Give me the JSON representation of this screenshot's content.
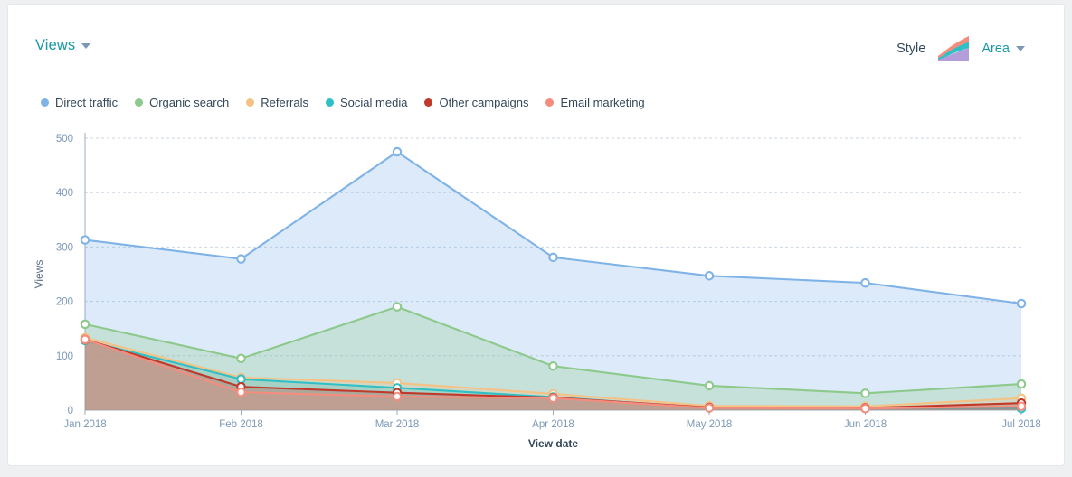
{
  "header": {
    "views_dropdown_label": "Views",
    "style_label": "Style",
    "style_dropdown_label": "Area",
    "caret_icon": "chevron-down-icon",
    "area_chart_icon": "area-chart-icon"
  },
  "colors": {
    "direct_traffic": "#7fb3e8",
    "organic_search": "#8cc98a",
    "referrals": "#f5c285",
    "social_media": "#2fc0c6",
    "other_campaigns": "#c0392b",
    "email_marketing": "#f58d7f",
    "accent_teal": "#1898a8",
    "text_dark": "#33475b",
    "tick_text": "#7c98b6",
    "grid": "#cbd6e2",
    "card_bg": "#ffffff",
    "page_bg": "#eef0f2"
  },
  "legend": [
    {
      "label": "Direct traffic",
      "color": "#7fb3e8"
    },
    {
      "label": "Organic search",
      "color": "#8cc98a"
    },
    {
      "label": "Referrals",
      "color": "#f5c285"
    },
    {
      "label": "Social media",
      "color": "#2fc0c6"
    },
    {
      "label": "Other campaigns",
      "color": "#c0392b"
    },
    {
      "label": "Email marketing",
      "color": "#f58d7f"
    }
  ],
  "chart_data": {
    "type": "area",
    "title": "",
    "xlabel": "View date",
    "ylabel": "Views",
    "categories": [
      "Jan 2018",
      "Feb 2018",
      "Mar 2018",
      "Apr 2018",
      "May 2018",
      "Jun 2018",
      "Jul 2018"
    ],
    "yticks": [
      0,
      100,
      200,
      300,
      400,
      500
    ],
    "ylim": [
      0,
      500
    ],
    "grid": true,
    "legend_position": "top-left",
    "stacked": false,
    "series": [
      {
        "name": "Direct traffic",
        "color": "#7fb3e8",
        "values": [
          313,
          278,
          475,
          281,
          247,
          234,
          196
        ]
      },
      {
        "name": "Organic search",
        "color": "#8cc98a",
        "values": [
          158,
          95,
          190,
          81,
          45,
          31,
          48
        ]
      },
      {
        "name": "Referrals",
        "color": "#f5c285",
        "values": [
          133,
          60,
          50,
          30,
          8,
          7,
          22
        ]
      },
      {
        "name": "Social media",
        "color": "#2fc0c6",
        "values": [
          128,
          57,
          41,
          24,
          4,
          3,
          3
        ]
      },
      {
        "name": "Other campaigns",
        "color": "#c0392b",
        "values": [
          130,
          43,
          32,
          23,
          5,
          4,
          13
        ]
      },
      {
        "name": "Email marketing",
        "color": "#f58d7f",
        "values": [
          130,
          33,
          25,
          22,
          4,
          3,
          7
        ]
      }
    ]
  }
}
